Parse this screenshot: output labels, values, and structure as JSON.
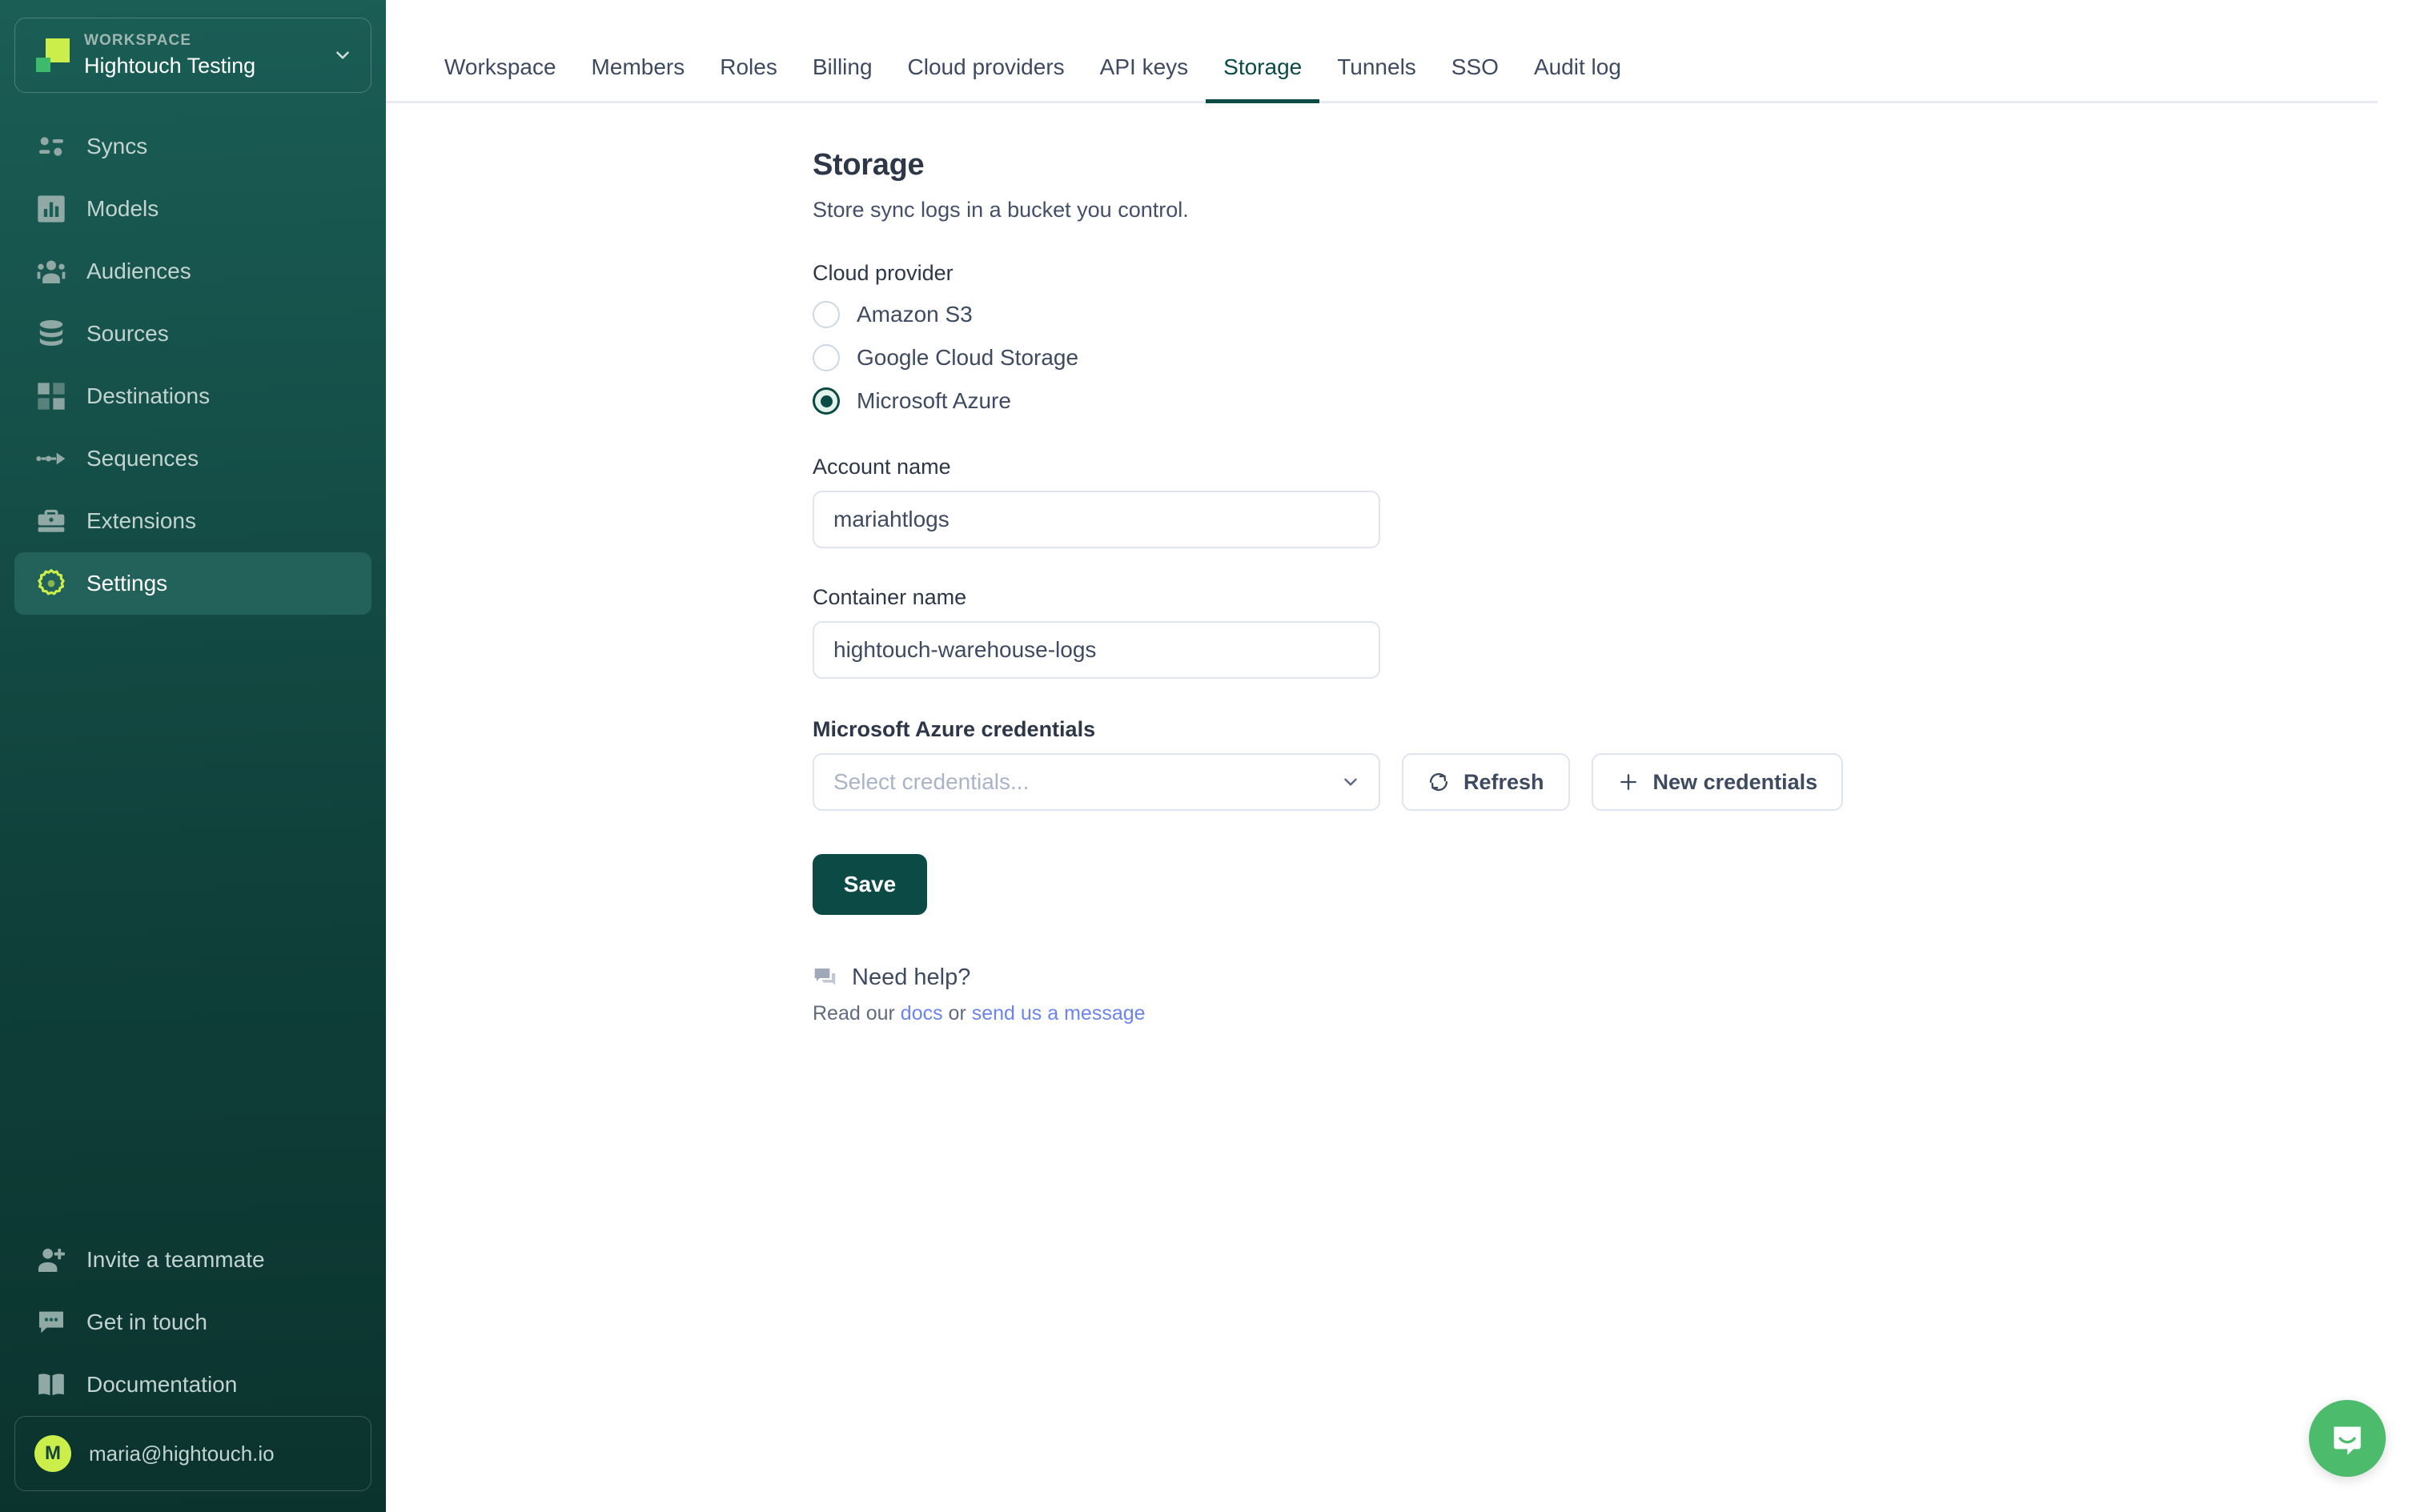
{
  "sidebar": {
    "workspace": {
      "label": "WORKSPACE",
      "name": "Hightouch Testing",
      "chevron_icon": "chevron-down-icon",
      "logo_icon": "hightouch-logo-icon"
    },
    "nav_items": [
      {
        "label": "Syncs",
        "icon": "syncs-icon",
        "active": false
      },
      {
        "label": "Models",
        "icon": "models-icon",
        "active": false
      },
      {
        "label": "Audiences",
        "icon": "audiences-icon",
        "active": false
      },
      {
        "label": "Sources",
        "icon": "sources-icon",
        "active": false
      },
      {
        "label": "Destinations",
        "icon": "destinations-icon",
        "active": false
      },
      {
        "label": "Sequences",
        "icon": "sequences-icon",
        "active": false
      },
      {
        "label": "Extensions",
        "icon": "extensions-icon",
        "active": false
      },
      {
        "label": "Settings",
        "icon": "gear-icon",
        "active": true
      }
    ],
    "bottom_items": [
      {
        "label": "Invite a teammate",
        "icon": "user-plus-icon"
      },
      {
        "label": "Get in touch",
        "icon": "chat-icon"
      },
      {
        "label": "Documentation",
        "icon": "book-icon"
      }
    ],
    "user": {
      "email": "maria@hightouch.io",
      "avatar_initial": "M"
    }
  },
  "tabs": [
    {
      "label": "Workspace",
      "active": false
    },
    {
      "label": "Members",
      "active": false
    },
    {
      "label": "Roles",
      "active": false
    },
    {
      "label": "Billing",
      "active": false
    },
    {
      "label": "Cloud providers",
      "active": false
    },
    {
      "label": "API keys",
      "active": false
    },
    {
      "label": "Storage",
      "active": true
    },
    {
      "label": "Tunnels",
      "active": false
    },
    {
      "label": "SSO",
      "active": false
    },
    {
      "label": "Audit log",
      "active": false
    }
  ],
  "page": {
    "title": "Storage",
    "subtitle": "Store sync logs in a bucket you control."
  },
  "cloud_provider": {
    "label": "Cloud provider",
    "options": [
      {
        "label": "Amazon S3",
        "selected": false
      },
      {
        "label": "Google Cloud Storage",
        "selected": false
      },
      {
        "label": "Microsoft Azure",
        "selected": true
      }
    ]
  },
  "account_name": {
    "label": "Account name",
    "value": "mariahtlogs",
    "placeholder": ""
  },
  "container_name": {
    "label": "Container name",
    "value": "hightouch-warehouse-logs",
    "placeholder": ""
  },
  "credentials": {
    "label": "Microsoft Azure credentials",
    "select_placeholder": "Select credentials...",
    "select_value": "",
    "chevron_icon": "chevron-down-icon",
    "refresh_label": "Refresh",
    "refresh_icon": "refresh-icon",
    "new_label": "New credentials",
    "new_icon": "plus-icon"
  },
  "save_label": "Save",
  "help": {
    "icon": "chat-bubble-icon",
    "title": "Need help?",
    "prefix": "Read our ",
    "docs_link": "docs",
    "middle": " or ",
    "message_link": "send us a message"
  },
  "intercom": {
    "icon": "intercom-messenger-icon"
  },
  "colors": {
    "sidebar_top": "#1a5e56",
    "sidebar_bottom": "#0b332e",
    "accent_lime": "#CBEE4A",
    "accent_green": "#3DBB6B",
    "primary_dark": "#0b4a45",
    "link_blue": "#6b84f0",
    "intercom_green": "#4cbb6c"
  }
}
